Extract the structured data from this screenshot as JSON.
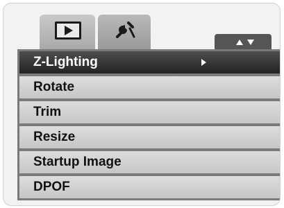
{
  "tabs": [
    {
      "id": "playback",
      "icon": "playback-icon",
      "active": true
    },
    {
      "id": "setup",
      "icon": "tools-icon",
      "active": false
    }
  ],
  "scroll_indicator": {
    "up_icon": "arrow-up-icon",
    "down_icon": "arrow-down-icon"
  },
  "menu": {
    "items": [
      {
        "label": "Z-Lighting",
        "selected": true,
        "has_submenu": true
      },
      {
        "label": "Rotate"
      },
      {
        "label": "Trim"
      },
      {
        "label": "Resize"
      },
      {
        "label": "Startup Image"
      },
      {
        "label": "DPOF"
      }
    ]
  },
  "colors": {
    "selected_bg": "#2e2e2e",
    "item_bg": "#d4d4d4",
    "frame": "#7a7a7a"
  }
}
